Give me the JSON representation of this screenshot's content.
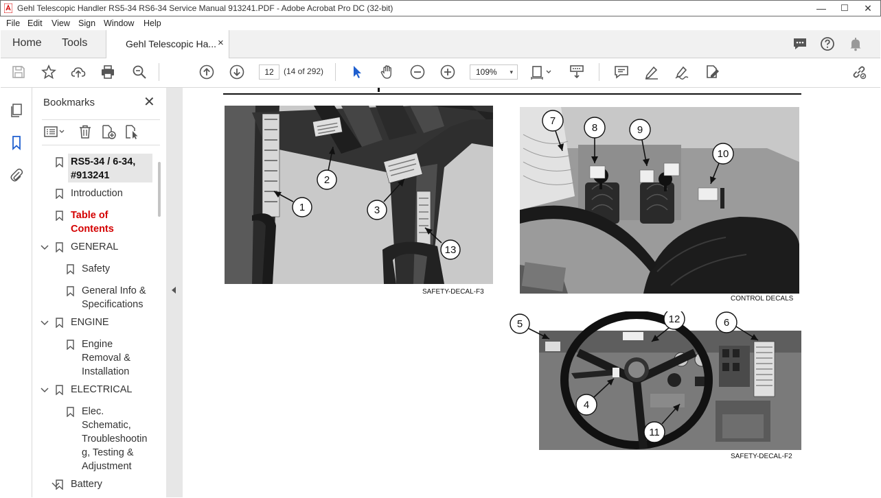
{
  "window": {
    "title": "Gehl Telescopic Handler RS5-34 RS6-34 Service Manual 913241.PDF - Adobe Acrobat Pro DC (32-bit)",
    "minimize": "—",
    "maximize": "☐",
    "close": "✕"
  },
  "menu": [
    "File",
    "Edit",
    "View",
    "Sign",
    "Window",
    "Help"
  ],
  "tabs": {
    "home": "Home",
    "tools": "Tools",
    "document": "Gehl Telescopic Ha...",
    "close": "×"
  },
  "toolbar": {
    "page_number": "12",
    "page_info": "(14 of 292)",
    "zoom": "109%",
    "zoom_dropdown": "▾"
  },
  "bookmarks": {
    "title": "Bookmarks",
    "close": "✕",
    "items": [
      {
        "label": "RS5-34 / 6-34, #913241"
      },
      {
        "label": "Introduction"
      },
      {
        "label": "Table of Contents"
      },
      {
        "label": "GENERAL"
      },
      {
        "label": "Safety"
      },
      {
        "label": "General Info & Specifications"
      },
      {
        "label": "ENGINE"
      },
      {
        "label": "Engine Removal & Installation"
      },
      {
        "label": "ELECTRICAL"
      },
      {
        "label": "Elec. Schematic, Troubleshooting, Testing & Adjustment"
      },
      {
        "label": "Battery"
      }
    ],
    "lines": {
      "rs534": [
        "RS5-34 / 6-34,",
        "#913241"
      ],
      "toc": [
        "Table of",
        "Contents"
      ],
      "geninfo": [
        "General Info &",
        "Specifications"
      ],
      "engine_rem": [
        "Engine",
        "Removal &",
        "Installation"
      ],
      "elec": [
        "Elec.",
        "Schematic,",
        "Troubleshootin",
        "g, Testing &",
        "Adjustment"
      ]
    }
  },
  "document": {
    "captions": {
      "fig1": "SAFETY-DECAL-F3",
      "fig2": "CONTROL DECALS",
      "fig3": "SAFETY-DECAL-F2"
    },
    "callouts": {
      "c1": "1",
      "c2": "2",
      "c3": "3",
      "c13": "13",
      "c7": "7",
      "c8": "8",
      "c9": "9",
      "c10": "10",
      "c5": "5",
      "c12": "12",
      "c6": "6",
      "c4": "4",
      "c11": "11"
    }
  },
  "colors": {
    "accent_red": "#d40000",
    "select_blue": "#1f5fcf",
    "icon_gray": "#555555"
  }
}
